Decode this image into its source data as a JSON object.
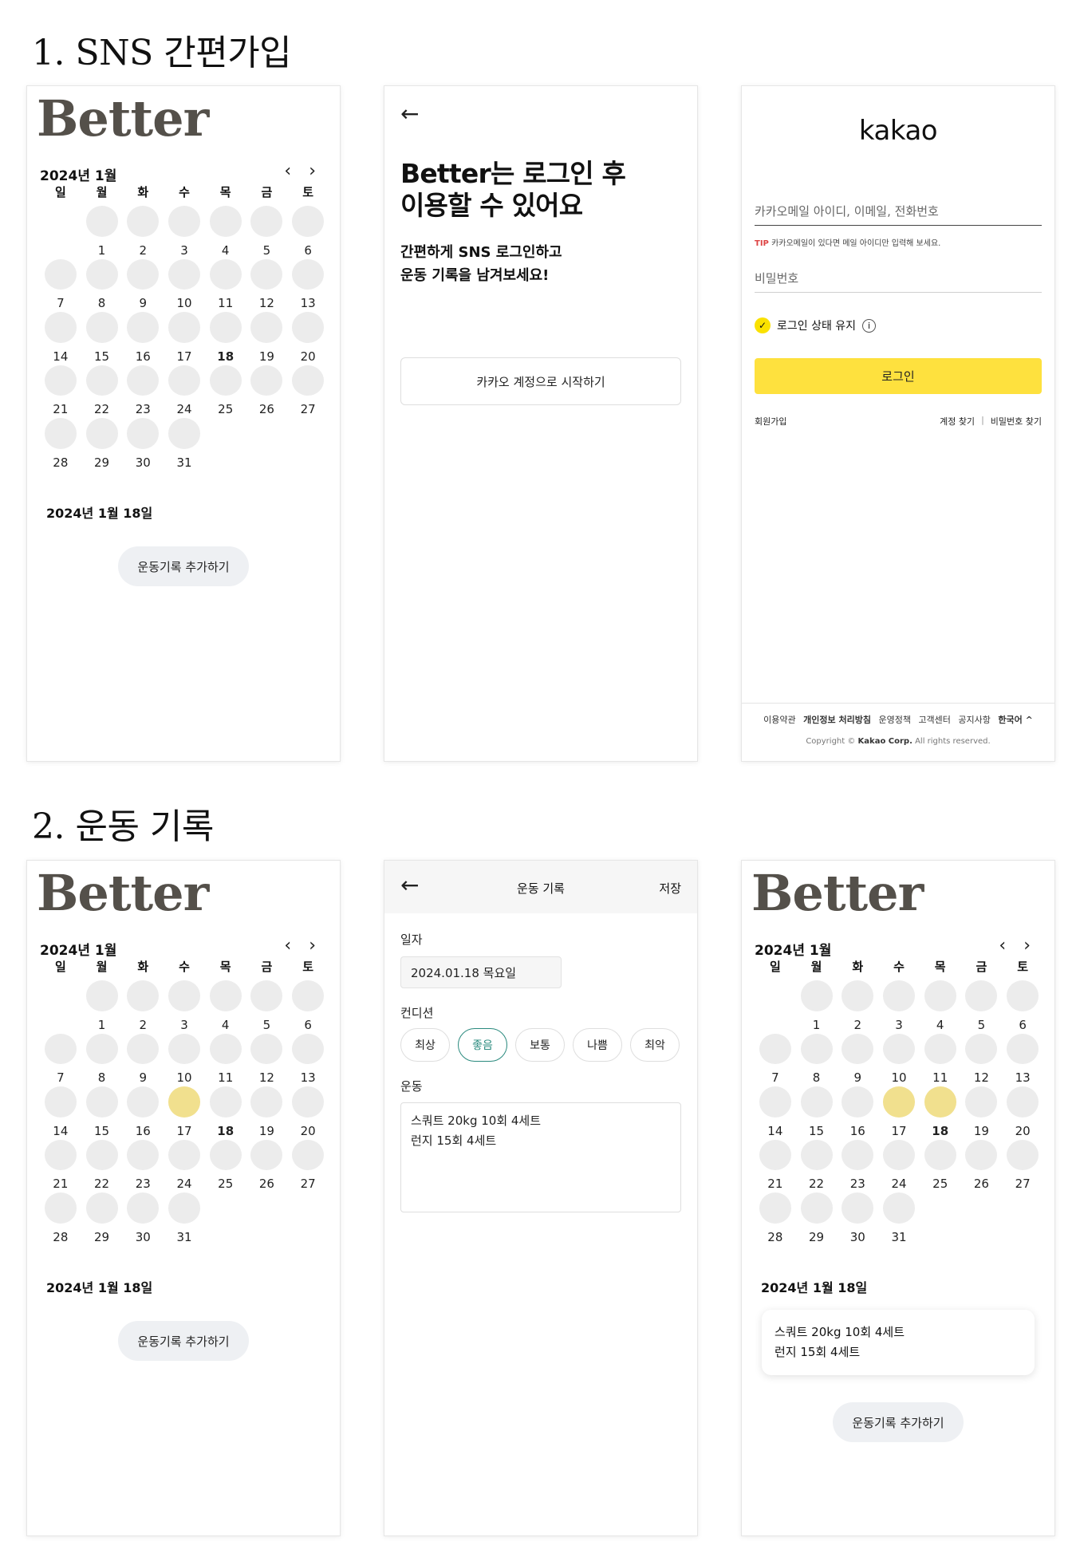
{
  "sections": {
    "signup_title": "1. SNS 간편가입",
    "record_title": "2. 운동 기록"
  },
  "calendar": {
    "logo": "Better",
    "month_label": "2024년 1월",
    "prev_icon": "chevron-left-icon",
    "next_icon": "chevron-right-icon",
    "weekdays": [
      "일",
      "월",
      "화",
      "수",
      "목",
      "금",
      "토"
    ],
    "leading_blanks": 1,
    "days": [
      "1",
      "2",
      "3",
      "4",
      "5",
      "6",
      "7",
      "8",
      "9",
      "10",
      "11",
      "12",
      "13",
      "14",
      "15",
      "16",
      "17",
      "18",
      "19",
      "20",
      "21",
      "22",
      "23",
      "24",
      "25",
      "26",
      "27",
      "28",
      "29",
      "30",
      "31"
    ],
    "today": "18",
    "selected_date": "2024년 1월 18일",
    "add_button": "운동기록 추가하기",
    "marked_days_screen4": [
      "17"
    ],
    "marked_days_screen6": [
      "17",
      "18"
    ]
  },
  "login_intro": {
    "back_icon": "arrow-left-icon",
    "headline_1": "Better는 로그인 후",
    "headline_2": "이용할 수 있어요",
    "sub_1": "간편하게 SNS 로그인하고",
    "sub_2": "운동 기록을 남겨보세요!",
    "kakao_button": "카카오 계정으로 시작하기"
  },
  "kakao": {
    "logo": "kakao",
    "id_placeholder": "카카오메일 아이디, 이메일, 전화번호",
    "tip_label": "TIP",
    "tip_text": "카카오메일이 있다면 메일 아이디만 입력해 보세요.",
    "pw_placeholder": "비밀번호",
    "keep_login": "로그인 상태 유지",
    "login_button": "로그인",
    "signup_link": "회원가입",
    "find_account": "계정 찾기",
    "find_password": "비밀번호 찾기",
    "footer": {
      "terms": "이용약관",
      "privacy": "개인정보 처리방침",
      "policy": "운영정책",
      "support": "고객센터",
      "notice": "공지사항",
      "language": "한국어 ^",
      "copyright_prefix": "Copyright ©",
      "copyright_company": "Kakao Corp.",
      "copyright_suffix": "All rights reserved."
    }
  },
  "record_form": {
    "back_icon": "arrow-left-icon",
    "title": "운동 기록",
    "save": "저장",
    "date_label": "일자",
    "date_value": "2024.01.18 목요일",
    "condition_label": "컨디션",
    "conditions": [
      "최상",
      "좋음",
      "보통",
      "나쁨",
      "최악"
    ],
    "selected_condition": "좋음",
    "exercise_label": "운동",
    "exercise_line_1": "스쿼트 20kg 10회 4세트",
    "exercise_line_2": "런지 15회 4세트"
  },
  "record_card": {
    "line_1": "스쿼트 20kg 10회 4세트",
    "line_2": "런지 15회 4세트"
  },
  "colors": {
    "accent_yellow": "#fee13e",
    "marked_day": "#f1e08e",
    "selected_chip": "#2a8a7e",
    "logo": "#54504a"
  }
}
